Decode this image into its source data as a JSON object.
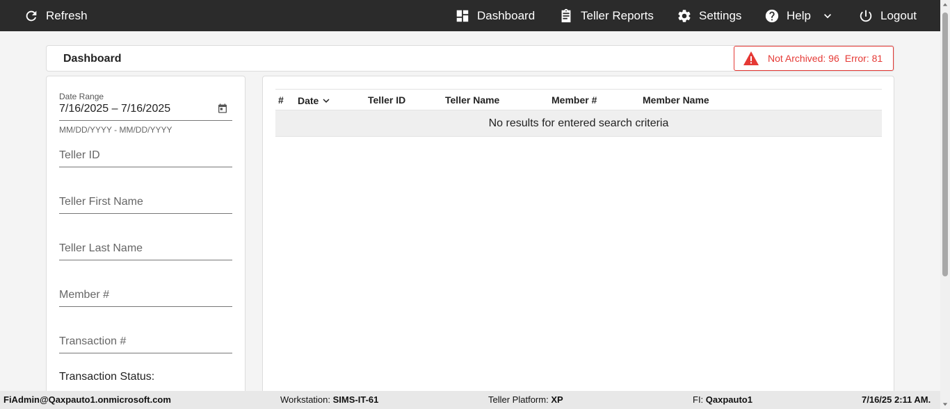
{
  "topbar": {
    "refresh": {
      "label": "Refresh",
      "icon": "refresh-icon"
    },
    "dashboard": {
      "label": "Dashboard",
      "icon": "dashboard-grid-icon"
    },
    "teller_reports": {
      "label": "Teller Reports",
      "icon": "clipboard-icon"
    },
    "settings": {
      "label": "Settings",
      "icon": "gear-icon"
    },
    "help": {
      "label": "Help",
      "icon": "help-circle-icon"
    },
    "logout": {
      "label": "Logout",
      "icon": "power-icon"
    }
  },
  "header": {
    "title": "Dashboard",
    "alert": {
      "not_archived": "Not Archived: 96",
      "error": "Error: 81",
      "color": "#e53935"
    }
  },
  "filters": {
    "date_range": {
      "label": "Date Range",
      "value": "7/16/2025 – 7/16/2025",
      "hint": "MM/DD/YYYY - MM/DD/YYYY"
    },
    "teller_id": {
      "placeholder": "Teller ID"
    },
    "teller_first_name": {
      "placeholder": "Teller First Name"
    },
    "teller_last_name": {
      "placeholder": "Teller Last Name"
    },
    "member_number": {
      "placeholder": "Member #"
    },
    "transaction_number": {
      "placeholder": "Transaction #"
    },
    "transaction_status_label": "Transaction Status:"
  },
  "table": {
    "columns": [
      "#",
      "Date",
      "Teller ID",
      "Teller Name",
      "Member #",
      "Member Name"
    ],
    "empty_message": "No results for entered search criteria"
  },
  "footer": {
    "user": "FiAdmin@Qaxpauto1.onmicrosoft.com",
    "workstation_label": "Workstation:",
    "workstation_value": "SIMS-IT-61",
    "platform_label": "Teller Platform:",
    "platform_value": "XP",
    "fi_label": "FI:",
    "fi_value": "Qaxpauto1",
    "datetime": "7/16/25 2:11 AM."
  }
}
